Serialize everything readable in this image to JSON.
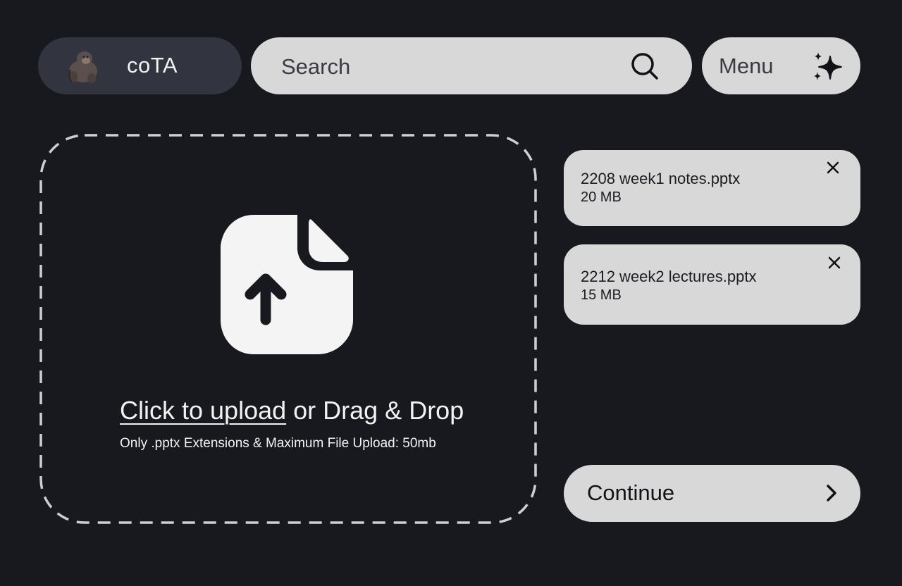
{
  "brand": {
    "name": "coTA",
    "avatar_icon": "gorilla-avatar-icon"
  },
  "search": {
    "placeholder": "Search",
    "icon": "search-icon"
  },
  "menu": {
    "label": "Menu",
    "icon": "sparkles-icon"
  },
  "upload": {
    "link_text": "Click to upload",
    "rest_text": " or Drag & Drop",
    "hint": "Only .pptx Extensions & Maximum File Upload: 50mb",
    "icon": "file-upload-icon"
  },
  "files": [
    {
      "name": "2208 week1 notes.pptx",
      "size": "20 MB"
    },
    {
      "name": "2212 week2 lectures.pptx",
      "size": "15 MB"
    }
  ],
  "continue": {
    "label": "Continue",
    "icon": "chevron-right-icon"
  },
  "colors": {
    "background": "#18191e",
    "brand_pill": "#32343f",
    "light_pill": "#d8d8d8",
    "dashed_border": "#cfcfd3",
    "file_icon": "#f4f4f4"
  }
}
